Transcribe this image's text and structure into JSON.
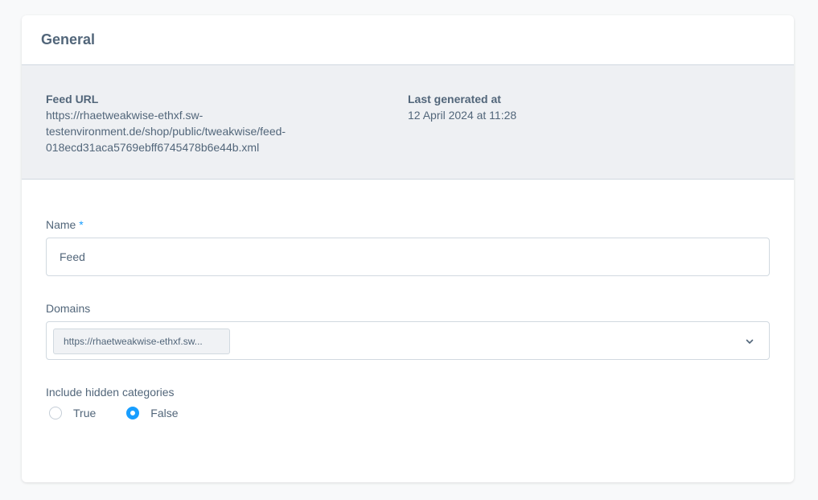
{
  "card": {
    "title": "General"
  },
  "info": {
    "feed_url_label": "Feed URL",
    "feed_url_value": "https://rhaetweakwise-ethxf.sw-testenvironment.de/shop/public/tweakwise/feed-018ecd31aca5769ebff6745478b6e44b.xml",
    "last_generated_label": "Last generated at",
    "last_generated_value": "12 April 2024 at 11:28"
  },
  "form": {
    "name_label": "Name",
    "name_required_marker": "*",
    "name_value": "Feed",
    "domains_label": "Domains",
    "domains_selected": [
      "https://rhaetweakwise-ethxf.sw..."
    ],
    "hidden_categories_label": "Include hidden categories",
    "options": [
      {
        "label": "True",
        "checked": false
      },
      {
        "label": "False",
        "checked": true
      }
    ]
  },
  "colors": {
    "accent": "#189eff",
    "text": "#52667a",
    "border": "#d1d9e0",
    "panel_bg": "#eef0f3"
  }
}
